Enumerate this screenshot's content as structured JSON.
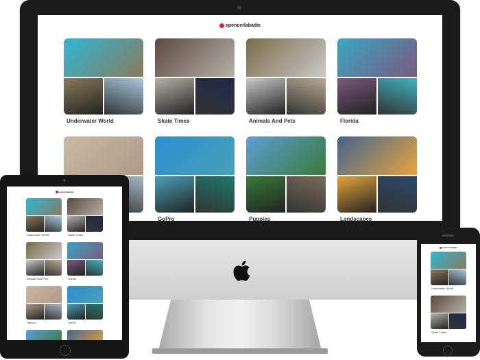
{
  "brand": {
    "name": "spencerlabadie",
    "accent": "#d9232d"
  },
  "albums": [
    {
      "title": "Underwater World",
      "colors": [
        "#2fb7d6",
        "#8a7a5a",
        "#a8c9e0"
      ]
    },
    {
      "title": "Skate Times",
      "colors": [
        "#5b4a3e",
        "#b5b0a8",
        "#1e2a4a"
      ]
    },
    {
      "title": "Animals And Pets",
      "colors": [
        "#7a6a48",
        "#c9c9c9",
        "#b8aa92"
      ]
    },
    {
      "title": "Florida",
      "colors": [
        "#3aa6c5",
        "#7a5a7e",
        "#3fb3c0"
      ]
    },
    {
      "title": "",
      "colors": [
        "#c9b9a3",
        "#b09a87",
        "#a8b7c3"
      ]
    },
    {
      "title": "GoPro",
      "colors": [
        "#2b8fd1",
        "#4aa0b8",
        "#1d7b6a"
      ]
    },
    {
      "title": "Puppies",
      "colors": [
        "#5e9ed6",
        "#3a7a3a",
        "#7a6c5a"
      ]
    },
    {
      "title": "Landscapes",
      "colors": [
        "#45638e",
        "#e6a53c",
        "#2a4a6a"
      ]
    }
  ],
  "ipad": {
    "albums": [
      {
        "title": "Underwater World",
        "colors": [
          "#2fb7d6",
          "#8a7a5a",
          "#a8c9e0"
        ]
      },
      {
        "title": "Skate Times",
        "colors": [
          "#5b4a3e",
          "#b5b0a8",
          "#1e2a4a"
        ]
      },
      {
        "title": "Animals And Pets",
        "colors": [
          "#7a6a48",
          "#c9c9c9",
          "#b8aa92"
        ]
      },
      {
        "title": "Florida",
        "colors": [
          "#3aa6c5",
          "#7a5a7e",
          "#3fb3c0"
        ]
      },
      {
        "title": "Tattoos",
        "colors": [
          "#c9b9a3",
          "#b09a87",
          "#a8b7c3"
        ]
      },
      {
        "title": "GoPro",
        "colors": [
          "#2b8fd1",
          "#4aa0b8",
          "#1d7b6a"
        ]
      },
      {
        "title": "",
        "colors": [
          "#5e9ed6",
          "#3a7a3a",
          "#7a6c5a"
        ]
      },
      {
        "title": "",
        "colors": [
          "#45638e",
          "#e6a53c",
          "#2a4a6a"
        ]
      }
    ]
  },
  "iphone": {
    "albums": [
      {
        "title": "Underwater World",
        "colors": [
          "#2fb7d6",
          "#8a7a5a",
          "#a8c9e0"
        ]
      },
      {
        "title": "Skate Times",
        "colors": [
          "#5b4a3e",
          "#b5b0a8",
          "#1e2a4a"
        ]
      }
    ]
  }
}
